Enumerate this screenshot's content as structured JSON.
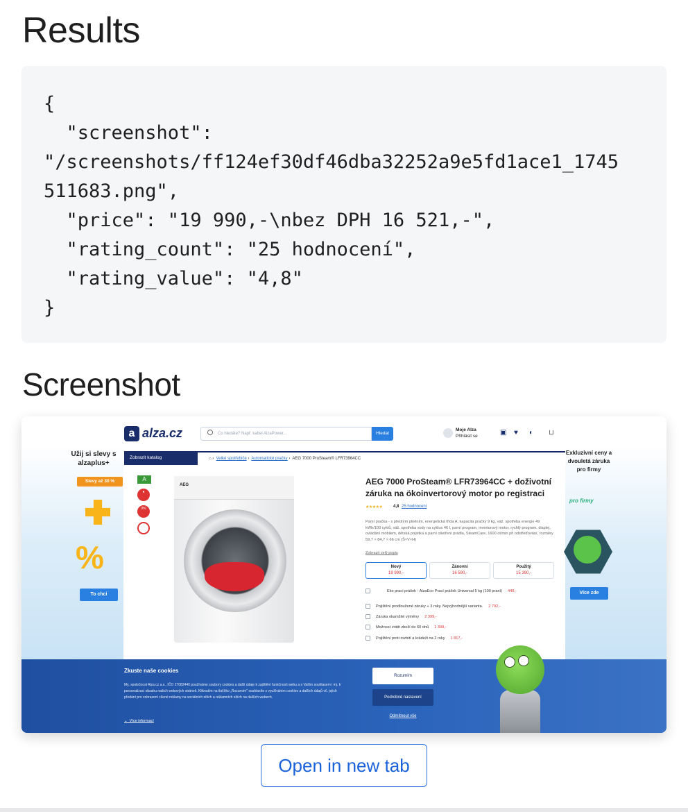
{
  "results_heading": "Results",
  "code_block": "{\n  \"screenshot\":\n\"/screenshots/ff124ef30df46dba32252a9e5fd1ace1_1745\n511683.png\",\n  \"price\": \"19 990,-\\nbez DPH 16 521,-\",\n  \"rating_count\": \"25 hodnocení\",\n  \"rating_value\": \"4,8\"\n}",
  "screenshot_heading": "Screenshot",
  "open_tab_label": "Open in new tab",
  "shot": {
    "logo": "alza.cz",
    "search_placeholder": "Co hledáte? Např. kabel AlzaPower...",
    "search_button": "Hledat",
    "user_name": "Moje Alza",
    "user_action": "Přihlásit se",
    "catalog": "Zobrazit katalog",
    "breadcrumb": [
      "Velké spotřebiče",
      "Automatické pračky",
      "AEG 7000 ProSteam® LFR73964CC"
    ],
    "product_title": "AEG 7000 ProSteam® LFR73964CC + doživotní záruka na ökoinvertorový motor po registraci",
    "rating_value": "4,8",
    "rating_count": "25 hodnocení",
    "description": "Pamí pračka - s předním plněním, energetická třída A, kapacita pračky 9 kg, váž. spotřeba energie 49 kWh/100 cyklů, váž. spotřeba vody na cyklus 46 l, parní program, invertorový motor, rychlý program, displej, ovládání mobilem, dětská pojistka a parní ošetření prádla, SteamCare, 1600 ot/min při odstřeďování, rozměry 59,7 × 84,7 × 66 cm (Š×V×H)",
    "description_link": "Zobrazit celý popis",
    "options": [
      {
        "name": "Nový",
        "price": "19 990,-"
      },
      {
        "name": "Zánovní",
        "price": "16 590,-"
      },
      {
        "name": "Použitý",
        "price": "15 390,-"
      }
    ],
    "addons": [
      {
        "label": "Eko prací prášek - AlzaEco Prací prášek Universal 5 kg (100 praní)",
        "price": "449,-"
      },
      {
        "label": "Pojištění prodloužené záruky + 3 roky. Nejvýhodnější varianta.",
        "price": "2 792,-"
      },
      {
        "label": "Záruka okamžité výměny",
        "price": "2 399,-"
      },
      {
        "label": "Možnost vrátit zboží do 60 dnů",
        "price": "1 399,-"
      },
      {
        "label": "Pojištění proti rozbití a krádeži na 2 roky",
        "price": "1 817,-"
      }
    ],
    "energy_class": "A",
    "left_ad_title": "Užij si slevy s alzaplus+",
    "left_ad_pill": "Slevy až 30 %",
    "left_ad_button": "To chci",
    "right_ad_title": "Exkluzivní ceny a dvouletá záruka pro firmy",
    "right_ad_brand": "pro firmy",
    "right_ad_button": "Více zde",
    "cookie_title": "Zkuste naše cookies",
    "cookie_text": "My, společnost Alza.cz a.s., IČO 27082440 používáme soubory cookies a další údaje k zajištění funkčnosti webu a s Vaším souhlasem i mj. k personalizaci obsahu našich webových stránek. Kliknutím na tlačítko „Rozumím\" souhlasíte s využíváním cookies a dalších údajů vč. jejich předání pro zobrazení cílené reklamy na sociálních sítích a reklamních sítích na dalších webech.",
    "cookie_more": "Více informací",
    "cookie_accept": "Rozumím",
    "cookie_settings": "Podrobné nastavení",
    "cookie_reject": "Odmítnout vše"
  }
}
